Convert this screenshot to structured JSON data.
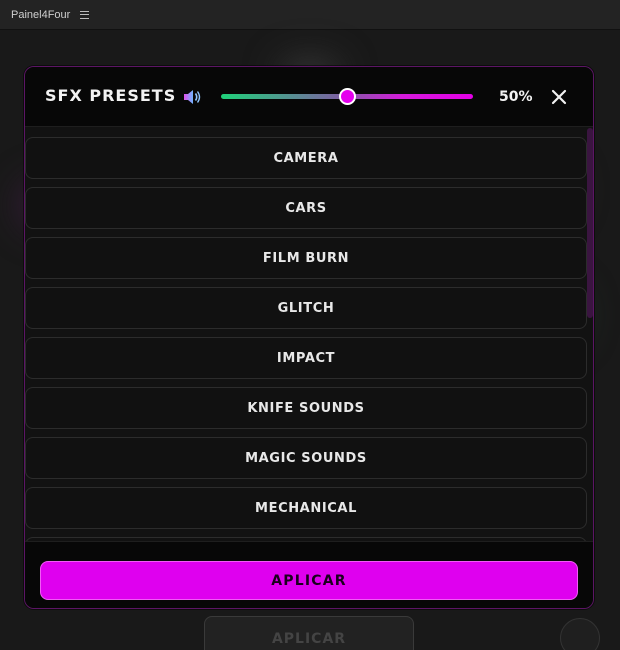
{
  "panel": {
    "title": "Painel4Four",
    "menu_icon": "hamburger-icon"
  },
  "background": {
    "apply_label": "APLICAR",
    "settings_icon": "gear-icon"
  },
  "modal": {
    "title": "SFX PRESETS",
    "speaker_icon": "speaker-icon",
    "volume": {
      "value": 0.5,
      "label": "50%"
    },
    "close_icon": "close-icon",
    "presets": [
      "CAMERA",
      "CARS",
      "FILM BURN",
      "GLITCH",
      "IMPACT",
      "KNIFE SOUNDS",
      "MAGIC SOUNDS",
      "MECHANICAL"
    ],
    "apply_label": "APLICAR"
  },
  "colors": {
    "accent": "#df00ef",
    "modal_border": "#5c1565",
    "slider_start": "#1fd27a",
    "slider_end": "#e300e6"
  }
}
